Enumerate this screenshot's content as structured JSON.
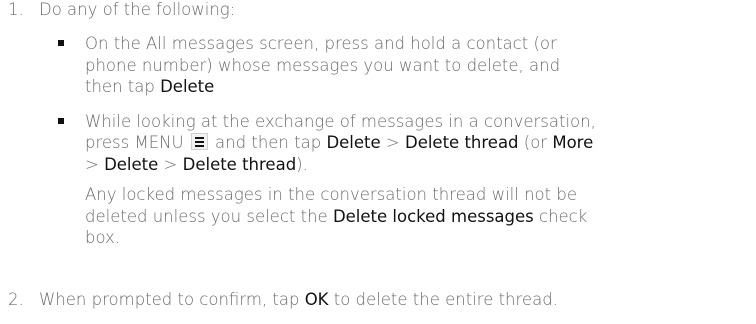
{
  "step1": {
    "number": "1.",
    "text": "Do any of the following:"
  },
  "bullets": [
    {
      "line1": "On the All messages screen, press and hold a contact (or",
      "line2": "phone number) whose messages you want to delete, and",
      "line3_prefix": "then tap ",
      "line3_bold": "Delete"
    },
    {
      "line1": "While looking at the exchange of messages in a conversation,",
      "line2_prefix": "press MENU ",
      "line2_mid": " and then tap ",
      "line2_bold1": "Delete",
      "line2_sep1": " > ",
      "line2_bold2": "Delete thread",
      "line2_paren": " (or ",
      "line2_bold3": "More",
      "line3_sep1": "> ",
      "line3_bold1": "Delete",
      "line3_sep2": " > ",
      "line3_bold2": "Delete thread",
      "line3_end": ").",
      "menu_icon": "menu-icon",
      "note": {
        "line1": "Any locked messages in the conversation thread will not be",
        "line2_prefix": "deleted unless you select the ",
        "line2_bold": "Delete locked messages",
        "line2_suffix": " check",
        "line3": "box."
      }
    }
  ],
  "step2": {
    "number": "2.",
    "prefix": "When prompted to confirm, tap ",
    "bold": "OK",
    "suffix": " to delete the entire thread."
  }
}
